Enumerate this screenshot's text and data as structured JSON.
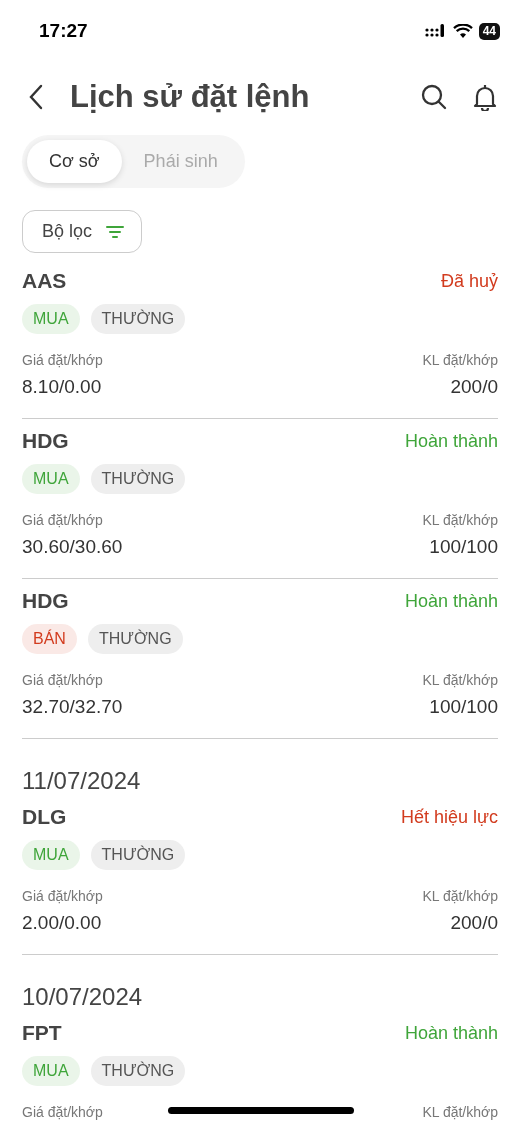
{
  "status_bar": {
    "time": "17:27",
    "battery": "44"
  },
  "header": {
    "title": "Lịch sử đặt lệnh"
  },
  "tabs": [
    {
      "label": "Cơ sở",
      "selected": true
    },
    {
      "label": "Phái sinh",
      "selected": false
    }
  ],
  "filter": {
    "label": "Bộ lọc"
  },
  "groups": [
    {
      "orders": [
        {
          "symbol": "AAS",
          "status": {
            "text": "Đã huỷ",
            "color": "#d23b1e"
          },
          "side": {
            "text": "MUA",
            "color": "#3fa53a"
          },
          "type": "THƯỜNG",
          "price_label": "Giá đặt/khớp",
          "price": "8.10/0.00",
          "volume_label": "KL đặt/khớp",
          "volume": "200/0"
        },
        {
          "symbol": "HDG",
          "status": {
            "text": "Hoàn thành",
            "color": "#3fa53a"
          },
          "side": {
            "text": "MUA",
            "color": "#3fa53a"
          },
          "type": "THƯỜNG",
          "price_label": "Giá đặt/khớp",
          "price": "30.60/30.60",
          "volume_label": "KL đặt/khớp",
          "volume": "100/100"
        },
        {
          "symbol": "HDG",
          "status": {
            "text": "Hoàn thành",
            "color": "#3fa53a"
          },
          "side": {
            "text": "BÁN",
            "color": "#d23b1e"
          },
          "type": "THƯỜNG",
          "price_label": "Giá đặt/khớp",
          "price": "32.70/32.70",
          "volume_label": "KL đặt/khớp",
          "volume": "100/100"
        }
      ]
    },
    {
      "date": "11/07/2024",
      "orders": [
        {
          "symbol": "DLG",
          "status": {
            "text": "Hết hiệu lực",
            "color": "#d23b1e"
          },
          "side": {
            "text": "MUA",
            "color": "#3fa53a"
          },
          "type": "THƯỜNG",
          "price_label": "Giá đặt/khớp",
          "price": "2.00/0.00",
          "volume_label": "KL đặt/khớp",
          "volume": "200/0"
        }
      ]
    },
    {
      "date": "10/07/2024",
      "orders": [
        {
          "symbol": "FPT",
          "status": {
            "text": "Hoàn thành",
            "color": "#3fa53a"
          },
          "side": {
            "text": "MUA",
            "color": "#3fa53a"
          },
          "type": "THƯỜNG",
          "price_label": "Giá đặt/khớp",
          "volume_label": "KL đặt/khớp"
        }
      ]
    }
  ]
}
